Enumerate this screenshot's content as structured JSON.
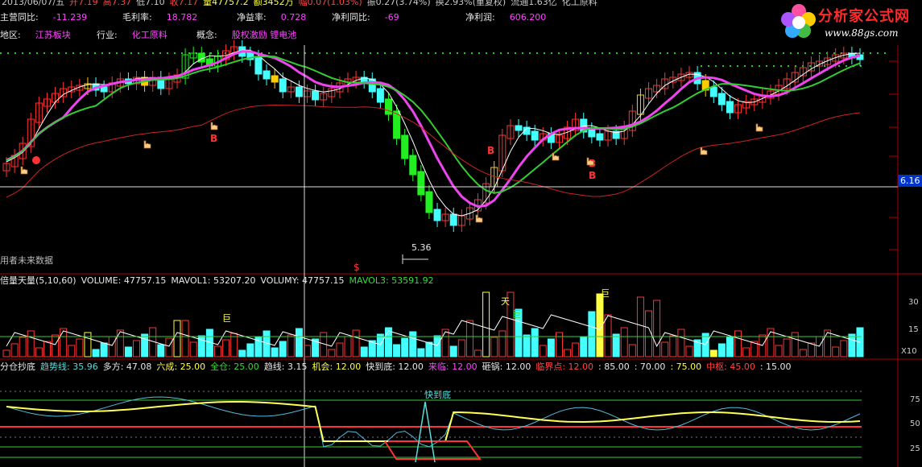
{
  "header": {
    "line1": [
      {
        "text": "2013/06/07/五",
        "color": "#c8c8c8"
      },
      {
        "text": "开7.19",
        "color": "#ff4444"
      },
      {
        "text": "高7.37",
        "color": "#ff4444"
      },
      {
        "text": "低7.10",
        "color": "#c8c8c8"
      },
      {
        "text": "收7.17",
        "color": "#ff4444"
      },
      {
        "text": "量47757.2",
        "color": "#ffff44"
      },
      {
        "text": "额3452万",
        "color": "#ffff44"
      },
      {
        "text": "幅0.07(1.03%)",
        "color": "#ff4444"
      },
      {
        "text": "振0.27(3.74%)",
        "color": "#c8c8c8"
      },
      {
        "text": "换2.93%(重复权)",
        "color": "#c8c8c8"
      },
      {
        "text": "流通1.63亿",
        "color": "#c8c8c8"
      },
      {
        "text": "化工原料",
        "color": "#c8c8c8"
      }
    ],
    "line2": [
      {
        "label": "主营同比:",
        "value": "-11.239"
      },
      {
        "label": "毛利率:",
        "value": "18.782"
      },
      {
        "label": "净益率:",
        "value": "0.728"
      },
      {
        "label": "净利同比:",
        "value": "-69"
      },
      {
        "label": "净利润:",
        "value": "606.200"
      }
    ],
    "line3": [
      {
        "label": "地区:",
        "value": "江苏板块"
      },
      {
        "label": "行业:",
        "value": "化工原料"
      },
      {
        "label": "概念:",
        "value": "股权激励 锂电池"
      }
    ]
  },
  "watermark": {
    "title": "分析家公式网",
    "url": "www.88gs.com"
  },
  "price_panel": {
    "price_tag": "6.16",
    "low_label": "5.36",
    "future_label": "用者未来数据",
    "b_markers": [
      "B",
      "B",
      "B",
      "B"
    ],
    "s_marker": "$"
  },
  "volume_panel": {
    "header": [
      {
        "text": "倍量天量(5,10,60)",
        "color": "#e8e8e8"
      },
      {
        "text": "VOLUME: 47757.15",
        "color": "#e8e8e8"
      },
      {
        "text": "MAVOL1: 53207.20",
        "color": "#e8e8e8"
      },
      {
        "text": "VOLUMY: 47757.15",
        "color": "#e8e8e8"
      },
      {
        "text": "MAVOL3: 53591.92",
        "color": "#33dd33"
      }
    ],
    "axis": [
      "30",
      "15",
      "X10"
    ],
    "annotations": [
      "巨",
      "天",
      "巨",
      "巨"
    ]
  },
  "indicator_panel": {
    "header": [
      {
        "text": "分仓抄底",
        "color": "#e8e8e8"
      },
      {
        "text": "趋势线: 35.96",
        "color": "#55dddd"
      },
      {
        "text": "多方: 47.08",
        "color": "#e8e8e8"
      },
      {
        "text": "六成: 25.00",
        "color": "#ffff44"
      },
      {
        "text": "全仓: 25.00",
        "color": "#33dd33"
      },
      {
        "text": "趋线: 3.15",
        "color": "#e8e8e8"
      },
      {
        "text": "机会: 12.00",
        "color": "#ffff44"
      },
      {
        "text": "快到底: 12.00",
        "color": "#e8e8e8"
      },
      {
        "text": "来临: 12.00",
        "color": "#ff44ff"
      },
      {
        "text": "砸锅: 12.00",
        "color": "#e8e8e8"
      },
      {
        "text": "临界点: 12.00",
        "color": "#ff4444"
      },
      {
        "text": ": 85.00",
        "color": "#e8e8e8"
      },
      {
        "text": ": 70.00",
        "color": "#e8e8e8"
      },
      {
        "text": ": 75.00",
        "color": "#ffff44"
      },
      {
        "text": "中枢: 45.00",
        "color": "#ff4444"
      },
      {
        "text": ": 15.00",
        "color": "#e8e8e8"
      }
    ],
    "annotation": "快到底",
    "axis": [
      "75",
      "50",
      "25"
    ]
  },
  "chart_data": {
    "type": "candlestick",
    "ylim": [
      5.2,
      7.5
    ],
    "current_price": 6.16,
    "low_price": 5.36,
    "colors": {
      "up": "#ff3333",
      "down": "#44ffff",
      "green_bar": "#22ee22",
      "ma_magenta": "#ee44ee",
      "ma_green": "#33cc33",
      "ma_white": "#ffffff",
      "ma_red": "#cc2222"
    }
  }
}
